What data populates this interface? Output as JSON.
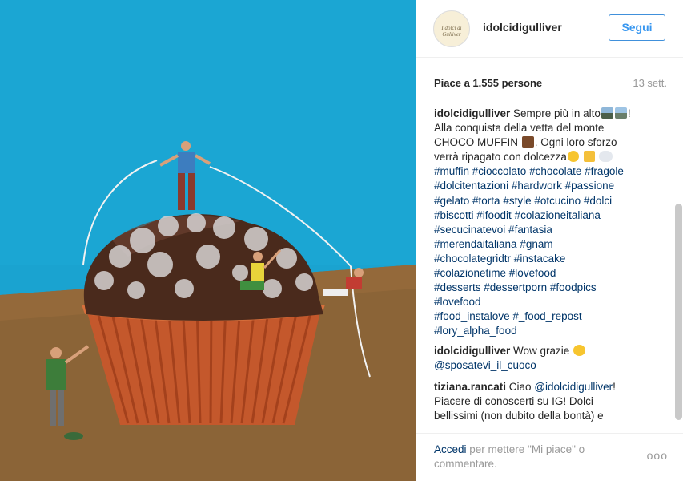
{
  "header": {
    "avatar_text": "I dolci di Gulliver",
    "username": "idolcidigulliver",
    "follow_label": "Segui"
  },
  "meta": {
    "likes": "Piace a 1.555 persone",
    "date": "13 sett."
  },
  "comments": [
    {
      "author": "idolcidigulliver",
      "lines": [
        "Sempre più in alto",
        "!",
        "Alla conquista della vetta del monte",
        "CHOCO MUFFIN",
        ". Ogni loro sforzo",
        "verrà ripagato con dolcezza"
      ],
      "hashtags": [
        "#muffin #cioccolato #chocolate  #fragole",
        "#dolcitentazioni #hardwork #passione",
        "#gelato #torta  #style  #otcucino #dolci",
        "#biscotti #ifoodit #colazioneitaliana",
        "#secucinatevoi #fantasia",
        "#merendaitaliana  #gnam",
        "#chocolategridtr #instacake",
        "#colazionetime #lovefood",
        "#desserts #dessertporn #foodpics",
        "#lovefood",
        "#food_instalove #_food_repost",
        "#lory_alpha_food"
      ]
    },
    {
      "author": "idolcidigulliver",
      "text": "Wow grazie",
      "mention": "@sposatevi_il_cuoco"
    },
    {
      "author": "tiziana.rancati",
      "text_before": "Ciao",
      "mention": "@idolcidigulliver",
      "text_after": "!",
      "lines": [
        "Piacere di conoscerti su IG! Dolci",
        "bellissimi (non dubito della bontà) e"
      ]
    }
  ],
  "footer": {
    "login_link": "Accedi",
    "login_text": " per mettere \"Mi piace\" o commentare.",
    "more": "ooo"
  },
  "colors": {
    "link": "#003569",
    "follow": "#3897f0",
    "muted": "#999999",
    "sky": "#1aa3d0",
    "wrapper": "#c0562b"
  }
}
